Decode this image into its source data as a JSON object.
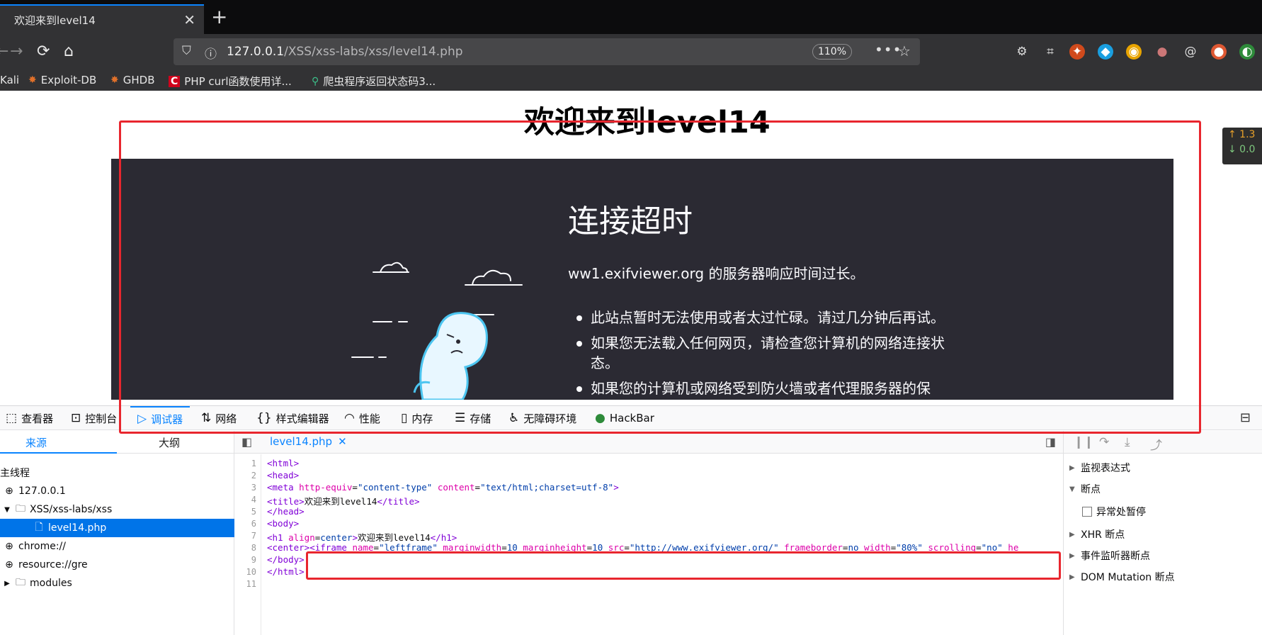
{
  "browser": {
    "tab_title": "欢迎来到level14",
    "tab_close": "✕",
    "new_tab": "+",
    "url_host": "127.0.0.1",
    "url_path": "/XSS/xss-labs/xss/level14.php",
    "zoom": "110%",
    "more": "•••",
    "bookmarks": [
      {
        "label": "Kali"
      },
      {
        "label": "Exploit-DB"
      },
      {
        "label": "GHDB"
      },
      {
        "label": "PHP curl函数使用详..."
      },
      {
        "label": "爬虫程序返回状态码3..."
      }
    ]
  },
  "page": {
    "title": "欢迎来到level14",
    "error_title": "连接超时",
    "error_desc": "ww1.exifviewer.org 的服务器响应时间过长。",
    "error_items": [
      "此站点暂时无法使用或者太过忙碌。请过几分钟后再试。",
      "如果您无法载入任何网页，请检查您计算机的网络连接状态。",
      "如果您的计算机或网络受到防火墙或者代理服务器的保"
    ]
  },
  "netspeed": {
    "up": "↑ 1.3",
    "down": "↓ 0.0"
  },
  "devtools": {
    "tabs": [
      {
        "label": "查看器"
      },
      {
        "label": "控制台"
      },
      {
        "label": "调试器"
      },
      {
        "label": "网络"
      },
      {
        "label": "样式编辑器"
      },
      {
        "label": "性能"
      },
      {
        "label": "内存"
      },
      {
        "label": "存储"
      },
      {
        "label": "无障碍环境"
      },
      {
        "label": "HackBar"
      }
    ],
    "source_tabs": {
      "sources": "来源",
      "outline": "大纲"
    },
    "tree": [
      {
        "label": "主线程"
      },
      {
        "label": "127.0.0.1"
      },
      {
        "label": "XSS/xss-labs/xss"
      },
      {
        "label": "level14.php"
      },
      {
        "label": "chrome://"
      },
      {
        "label": "resource://gre"
      },
      {
        "label": "modules"
      }
    ],
    "editor_file": "level14.php",
    "code": {
      "l1": "<html>",
      "l2": "<head>",
      "l3_tag_open": "<meta ",
      "l3_a1": "http-equiv",
      "l3_v1": "\"content-type\"",
      "l3_a2": "content",
      "l3_v2": "\"text/html;charset=utf-8\"",
      "l3_tag_close": ">",
      "l4_open": "<title>",
      "l4_text": "欢迎来到level14",
      "l4_close": "</title>",
      "l5": "</head>",
      "l6": "<body>",
      "l7_open": "<h1 ",
      "l7_a": "align",
      "l7_v": "center",
      "l7_text": "欢迎来到level14",
      "l7_close": "</h1>",
      "l8_center": "<center>",
      "l8_iframe": "<iframe ",
      "l8_a1": "name",
      "l8_v1": "\"leftframe\"",
      "l8_a2": "marginwidth",
      "l8_v2": "10",
      "l8_a3": "marginheight",
      "l8_v3": "10",
      "l8_a4": "src",
      "l8_v4": "\"http://www.exifviewer.org/\"",
      "l8_a5": "frameborder",
      "l8_v5": "no",
      "l8_a6": "width",
      "l8_v6": "\"80%\"",
      "l8_a7": "scrolling",
      "l8_v7": "\"no\"",
      "l8_a8": "he",
      "l9": "</body>",
      "l10": "</html>"
    },
    "debugger": {
      "watch": "监视表达式",
      "breakpoints": "断点",
      "pause_on_exceptions": "异常处暂停",
      "xhr": "XHR 断点",
      "event_listeners": "事件监听器断点",
      "dom_mutation": "DOM Mutation 断点"
    }
  },
  "colors": {
    "accent": "#0a84ff",
    "annotation": "#e8262e",
    "error_bg": "#2b2a33"
  }
}
